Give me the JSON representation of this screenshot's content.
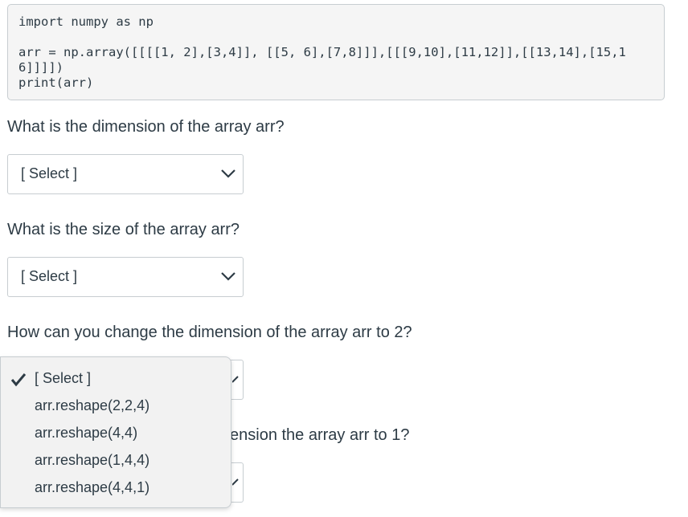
{
  "code": {
    "line1": "import numpy as np",
    "line2": "arr = np.array([[[[1, 2],[3,4]], [[5, 6],[7,8]]],[[[9,10],[11,12]],[[13,14],[15,1",
    "line3": "6]]]])",
    "line4": "print(arr)"
  },
  "questions": [
    {
      "text": "What is the dimension of the array arr?",
      "selected": "[ Select ]"
    },
    {
      "text": "What is the size of the array arr?",
      "selected": "[ Select ]"
    },
    {
      "text": "How can you change the dimension of the array arr to 2?",
      "selected": "[ Select ]"
    },
    {
      "text_visible": "ension the array arr to 1?"
    }
  ],
  "dropdown": {
    "options": [
      {
        "label": "[ Select ]",
        "checked": true
      },
      {
        "label": "arr.reshape(2,2,4)"
      },
      {
        "label": "arr.reshape(4,4)"
      },
      {
        "label": "arr.reshape(1,4,4)"
      },
      {
        "label": "arr.reshape(4,4,1)"
      }
    ]
  },
  "icons": {
    "chevron": "chevron-down-icon",
    "check": "checkmark-icon"
  }
}
